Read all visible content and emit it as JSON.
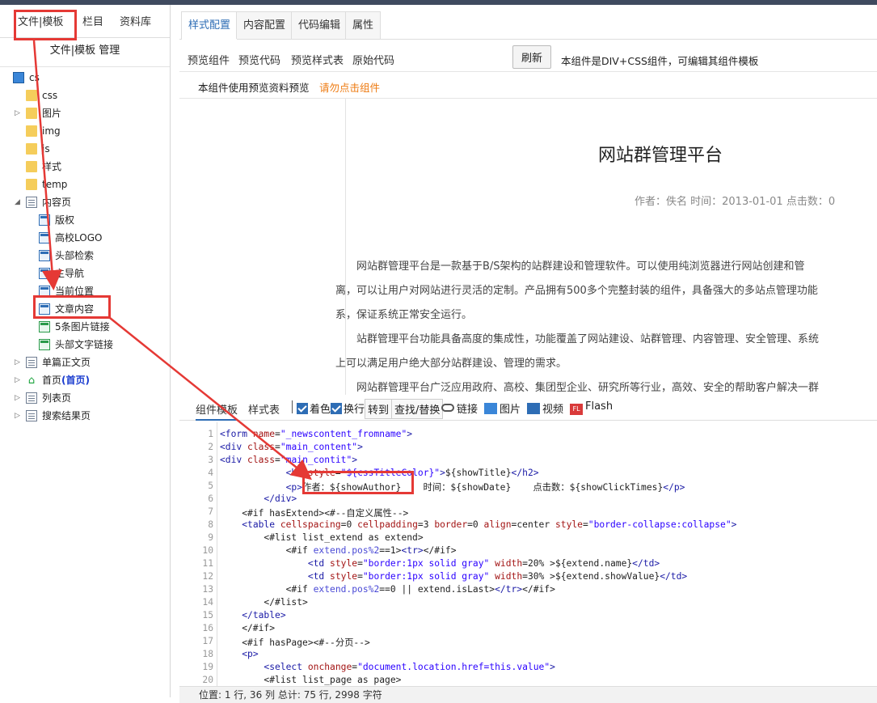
{
  "left": {
    "tabs": [
      "文件|模板",
      "栏目",
      "资料库"
    ],
    "subtitle": "文件|模板 管理",
    "tree": [
      {
        "label": "cs",
        "icon": "monitor-icon",
        "level": 0
      },
      {
        "label": "css",
        "icon": "folder-icon",
        "level": 1
      },
      {
        "label": "图片",
        "icon": "folder-icon",
        "level": 1,
        "expandable": true
      },
      {
        "label": "img",
        "icon": "folder-icon",
        "level": 1
      },
      {
        "label": "js",
        "icon": "folder-icon",
        "level": 1
      },
      {
        "label": "样式",
        "icon": "gear-folder-icon",
        "level": 1
      },
      {
        "label": "temp",
        "icon": "folder-icon",
        "level": 1
      },
      {
        "label": "内容页",
        "icon": "page-icon",
        "level": 1,
        "expanded": true
      },
      {
        "label": "版权",
        "icon": "component-icon",
        "level": 2
      },
      {
        "label": "高校LOGO",
        "icon": "component-icon",
        "level": 2
      },
      {
        "label": "头部检索",
        "icon": "component-icon",
        "level": 2
      },
      {
        "label": "主导航",
        "icon": "component-icon",
        "level": 2
      },
      {
        "label": "当前位置",
        "icon": "component-icon",
        "level": 2
      },
      {
        "label": "文章内容",
        "icon": "component-icon",
        "level": 2
      },
      {
        "label": "5条图片链接",
        "icon": "component-green-icon",
        "level": 2
      },
      {
        "label": "头部文字链接",
        "icon": "component-green-icon",
        "level": 2
      },
      {
        "label": "单篇正文页",
        "icon": "page-icon",
        "level": 1,
        "expandable": true
      },
      {
        "label": "首页",
        "label_suffix": "(首页)",
        "icon": "home-icon",
        "level": 1,
        "expandable": true
      },
      {
        "label": "列表页",
        "icon": "page-icon",
        "level": 1,
        "expandable": true
      },
      {
        "label": "搜索结果页",
        "icon": "page-icon",
        "level": 1,
        "expandable": true
      }
    ]
  },
  "right": {
    "tabs": [
      "样式配置",
      "内容配置",
      "代码编辑",
      "属性"
    ],
    "active_tab": "样式配置",
    "subtabs": [
      "预览组件",
      "预览代码",
      "预览样式表",
      "原始代码"
    ],
    "refresh_label": "刷新",
    "component_note": "本组件是DIV+CSS组件，可编辑其组件模板",
    "preview_note": "本组件使用预览资料预览",
    "preview_warning": "请勿点击组件",
    "preview": {
      "title": "网站群管理平台",
      "meta": "作者：佚名 时间：2013-01-01 点击数：0",
      "paragraph_lines": [
        "　　网站群管理平台是一款基于B/S架构的站群建设和管理软件。可以使用纯浏览器进行网站创建和管",
        "离，可以让用户对网站进行灵活的定制。产品拥有500多个完整封装的组件，具备强大的多站点管理功能",
        "系，保证系统正常安全运行。",
        "　　站群管理平台功能具备高度的集成性，功能覆盖了网站建设、站群管理、内容管理、安全管理、系统",
        "上可以满足用户绝大部分站群建设、管理的需求。",
        "　　网站群管理平台广泛应用政府、高校、集团型企业、研究所等行业，高效、安全的帮助客户解决一群"
      ]
    },
    "editor": {
      "tabs": [
        "组件模板",
        "样式表"
      ],
      "checkboxes": [
        "着色",
        "换行"
      ],
      "buttons": [
        "转到",
        "查找/替换"
      ],
      "tools": [
        "链接",
        "图片",
        "视频",
        "Flash"
      ],
      "status": "位置:    1 行, 36 列        总计: 75 行, 2998 字符"
    }
  },
  "annotations": {
    "highlight_tab": "文件|模板",
    "highlight_node": "文章内容",
    "highlight_code": "作者：${showAuthor}"
  }
}
